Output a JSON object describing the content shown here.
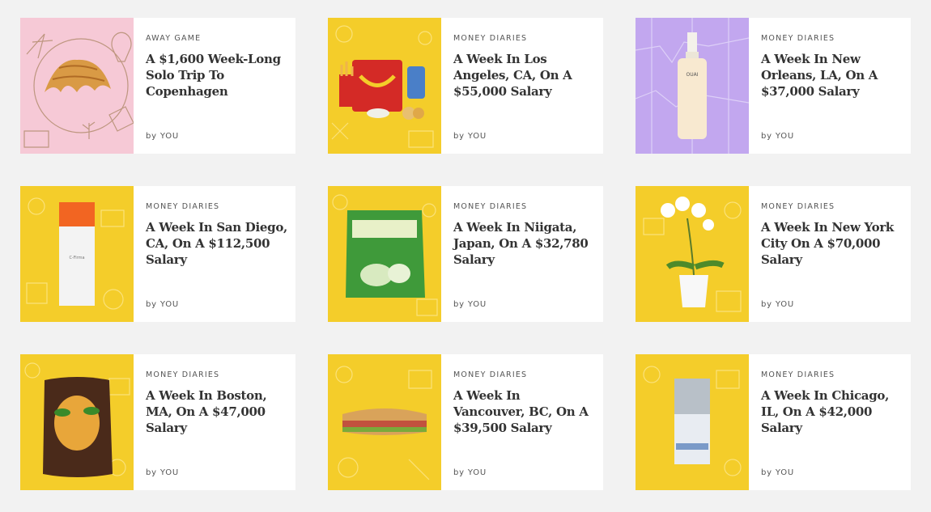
{
  "colors": {
    "page_bg": "#f2f2f2",
    "card_bg": "#ffffff",
    "yellow_bg": "#f4cd2a",
    "pink_bg": "#f6c9d6",
    "purple_bg": "#c2a7ef"
  },
  "articles": [
    {
      "category": "AWAY GAME",
      "title": "A $1,600 Week-Long Solo Trip To Copenhagen",
      "byline": "by YOU",
      "image_icon": "croissant-icon"
    },
    {
      "category": "MONEY DIARIES",
      "title": "A Week In Los Angeles, CA, On A $55,000 Salary",
      "byline": "by YOU",
      "image_icon": "happy-meal-icon"
    },
    {
      "category": "MONEY DIARIES",
      "title": "A Week In New Orleans, LA, On A $37,000 Salary",
      "byline": "by YOU",
      "image_icon": "spray-bottle-icon"
    },
    {
      "category": "MONEY DIARIES",
      "title": "A Week In San Diego, CA, On A $112,500 Salary",
      "byline": "by YOU",
      "image_icon": "serum-bottle-icon"
    },
    {
      "category": "MONEY DIARIES",
      "title": "A Week In Niigata, Japan, On A $32,780 Salary",
      "byline": "by YOU",
      "image_icon": "snack-bag-icon"
    },
    {
      "category": "MONEY DIARIES",
      "title": "A Week In New York City On A $70,000 Salary",
      "byline": "by YOU",
      "image_icon": "orchid-icon"
    },
    {
      "category": "MONEY DIARIES",
      "title": "A Week In Boston, MA, On A $47,000 Salary",
      "byline": "by YOU",
      "image_icon": "mango-bag-icon"
    },
    {
      "category": "MONEY DIARIES",
      "title": "A Week In Vancouver, BC, On A $39,500 Salary",
      "byline": "by YOU",
      "image_icon": "sandwich-icon"
    },
    {
      "category": "MONEY DIARIES",
      "title": "A Week In Chicago, IL, On A $42,000 Salary",
      "byline": "by YOU",
      "image_icon": "sunscreen-bottle-icon"
    }
  ]
}
